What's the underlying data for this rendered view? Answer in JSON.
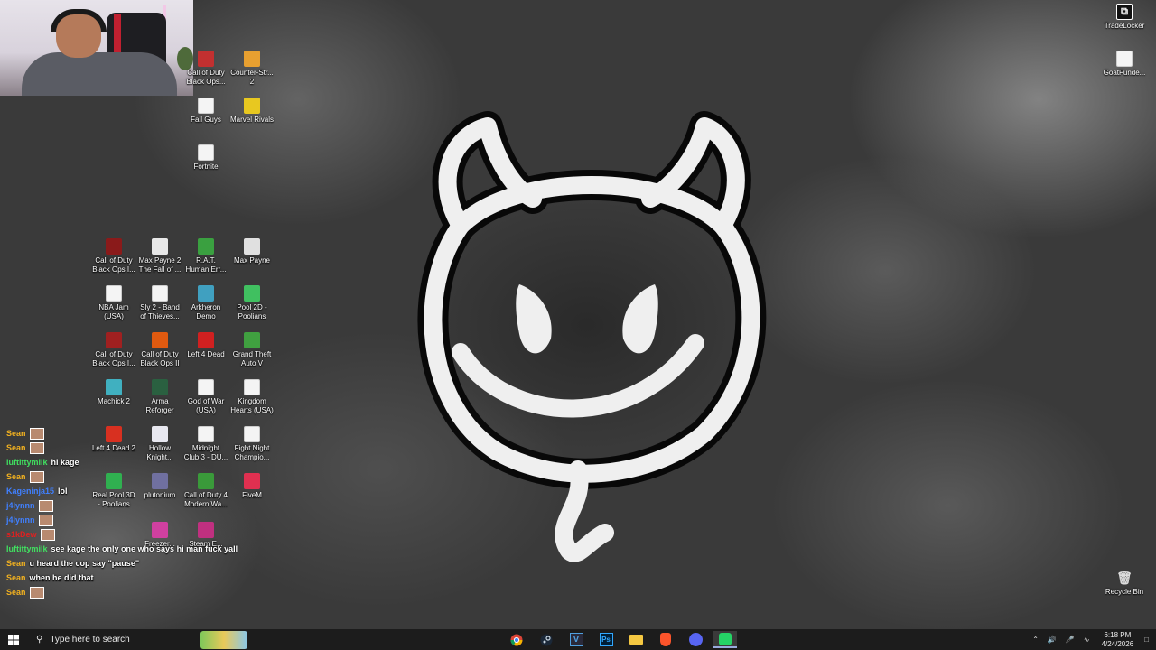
{
  "desktop_icons": [
    {
      "label": "Call of Duty\nBlack Ops...",
      "icon": "cod-black-ops-icon",
      "color": "#c23030"
    },
    {
      "label": "Counter-Str...\n2",
      "icon": "counter-strike-icon",
      "color": "#e8a030"
    },
    {
      "label": "Fall Guys",
      "icon": "document-icon",
      "color": "#f4f4f4"
    },
    {
      "label": "Marvel Rivals",
      "icon": "marvel-rivals-icon",
      "color": "#e8c820"
    },
    {
      "label": "Fortnite",
      "icon": "document-icon",
      "color": "#f4f4f4"
    },
    {
      "label": "Call of Duty\nBlack Ops I...",
      "icon": "cod-icon",
      "color": "#8a1a1a"
    },
    {
      "label": "Max Payne 2\nThe Fall of ...",
      "icon": "max-payne-2-icon",
      "color": "#e8e8e8"
    },
    {
      "label": "R.A.T.\nHuman Err...",
      "icon": "rat-icon",
      "color": "#3aa040"
    },
    {
      "label": "Max Payne",
      "icon": "max-payne-icon",
      "color": "#e0e0e0"
    },
    {
      "label": "NBA Jam\n(USA)",
      "icon": "document-icon",
      "color": "#f4f4f4"
    },
    {
      "label": "Sly 2 - Band\nof Thieves...",
      "icon": "document-icon",
      "color": "#f4f4f4"
    },
    {
      "label": "Arkheron\nDemo",
      "icon": "arkheron-icon",
      "color": "#40a0c0"
    },
    {
      "label": "Pool 2D -\nPoolians",
      "icon": "pool-2d-icon",
      "color": "#40c060"
    },
    {
      "label": "Call of Duty\nBlack Ops I...",
      "icon": "cod-icon",
      "color": "#a02020"
    },
    {
      "label": "Call of Duty\nBlack Ops II",
      "icon": "cod-bo2-icon",
      "color": "#e05a10"
    },
    {
      "label": "Left 4 Dead",
      "icon": "left-4-dead-icon",
      "color": "#d02020"
    },
    {
      "label": "Grand Theft\nAuto V",
      "icon": "gta-v-icon",
      "color": "#40a040"
    },
    {
      "label": "Machick 2",
      "icon": "machick-icon",
      "color": "#40b0c0"
    },
    {
      "label": "Arma\nReforger",
      "icon": "arma-icon",
      "color": "#2a6040"
    },
    {
      "label": "God of War\n(USA)",
      "icon": "document-icon",
      "color": "#f4f4f4"
    },
    {
      "label": "Kingdom\nHearts (USA)",
      "icon": "document-icon",
      "color": "#f4f4f4"
    },
    {
      "label": "Left 4 Dead 2",
      "icon": "left-4-dead-2-icon",
      "color": "#d83020"
    },
    {
      "label": "Hollow\nKnight...",
      "icon": "hollow-knight-icon",
      "color": "#e8e8f0"
    },
    {
      "label": "Midnight\nClub 3 - DU...",
      "icon": "document-icon",
      "color": "#f4f4f4"
    },
    {
      "label": "Fight Night\nChampio...",
      "icon": "document-icon",
      "color": "#f4f4f4"
    },
    {
      "label": "Real Pool 3D\n- Poolians",
      "icon": "real-pool-icon",
      "color": "#30b050"
    },
    {
      "label": "plutonium",
      "icon": "plutonium-icon",
      "color": "#7070a0"
    },
    {
      "label": "Call of Duty 4\nModern Wa...",
      "icon": "cod4-icon",
      "color": "#3a9a3a"
    },
    {
      "label": "FiveM",
      "icon": "fivem-icon",
      "color": "#e03050"
    },
    {
      "label": "Freezer...",
      "icon": "freezer-icon",
      "color": "#d040a0"
    },
    {
      "label": "Steam E...",
      "icon": "steam-e-icon",
      "color": "#c03080"
    }
  ],
  "right_icons": [
    {
      "label": "TradeLocker",
      "icon": "tradelocker-icon"
    },
    {
      "label": "GoatFunde...",
      "icon": "goatfunded-icon"
    },
    {
      "label": "Recycle Bin",
      "icon": "recycle-bin-icon"
    }
  ],
  "chat": [
    {
      "user": "Sean",
      "color": "#f0b020",
      "avatar": true,
      "text": ""
    },
    {
      "user": "Sean",
      "color": "#f0b020",
      "avatar": true,
      "text": ""
    },
    {
      "user": "luftittymilk",
      "color": "#40e060",
      "avatar": false,
      "text": "hi kage"
    },
    {
      "user": "Sean",
      "color": "#f0b020",
      "avatar": true,
      "text": ""
    },
    {
      "user": "Kageninja15",
      "color": "#4080ff",
      "avatar": false,
      "text": "lol"
    },
    {
      "user": "j4lynnn",
      "color": "#4080ff",
      "avatar": true,
      "text": ""
    },
    {
      "user": "j4lynnn",
      "color": "#4080ff",
      "avatar": true,
      "text": ""
    },
    {
      "user": "s1kDew",
      "color": "#e02020",
      "avatar": true,
      "text": ""
    },
    {
      "user": "luftittymilk",
      "color": "#40e060",
      "avatar": false,
      "text": "see kage the only one who says hi man fuck yall"
    },
    {
      "user": "Sean",
      "color": "#f0b020",
      "avatar": false,
      "text": "u heard the cop say \"pause\""
    },
    {
      "user": "Sean",
      "color": "#f0b020",
      "avatar": false,
      "text": "when he did that"
    },
    {
      "user": "Sean",
      "color": "#f0b020",
      "avatar": true,
      "text": ""
    }
  ],
  "taskbar": {
    "search_placeholder": "Type here to search",
    "apps": [
      "chrome-icon",
      "steam-icon",
      "vscode-icon",
      "photoshop-icon",
      "file-explorer-icon",
      "brave-icon",
      "discord-icon",
      "whatsapp-icon"
    ],
    "time": "6:18 PM",
    "date": "4/24/2026"
  }
}
